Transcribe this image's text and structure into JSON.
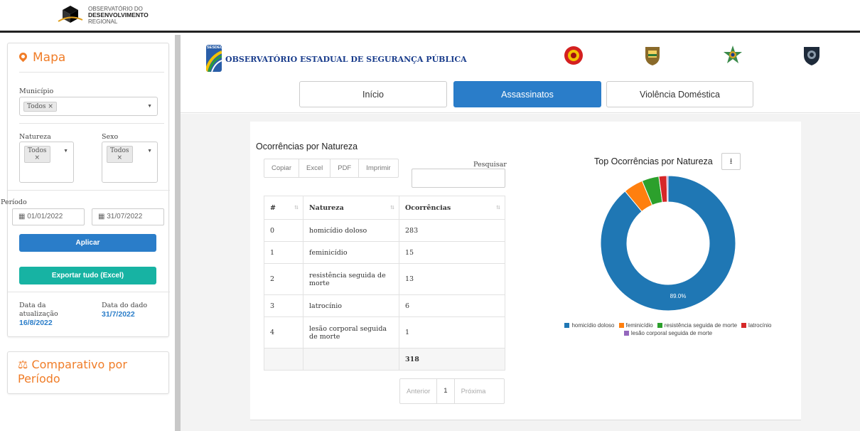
{
  "brand": {
    "line1": "OBSERVATÓRIO DO",
    "line2": "DESENVOLVIMENTO",
    "line3": "REGIONAL"
  },
  "sidebar": {
    "mapa_title": "Mapa",
    "municipio_label": "Município",
    "municipio_tag": "Todos ×",
    "natureza_label": "Natureza",
    "natureza_tag_1": "Todos",
    "natureza_tag_2": "×",
    "sexo_label": "Sexo",
    "sexo_tag_1": "Todos",
    "sexo_tag_2": "×",
    "periodo_label": "Período",
    "date_start": "01/01/2022",
    "date_end": "31/07/2022",
    "aplicar": "Aplicar",
    "exportar": "Exportar tudo (Excel)",
    "data_atualizacao_label_1": "Data da",
    "data_atualizacao_label_2": "atualização",
    "data_atualizacao": "16/8/2022",
    "data_dado_label": "Data do dado",
    "data_dado": "31/7/2022",
    "comparativo_line1": "Comparativo por",
    "comparativo_line2": "Período"
  },
  "header": {
    "sesdec": "SESDEC",
    "title": "OBSERVATÓRIO ESTADUAL DE SEGURANÇA PÚBLICA",
    "tabs": [
      {
        "label": "Início"
      },
      {
        "label": "Assassinatos"
      },
      {
        "label": "Violência Doméstica"
      }
    ]
  },
  "table_section": {
    "title": "Ocorrências por Natureza",
    "buttons": [
      "Copiar",
      "Excel",
      "PDF",
      "Imprimir"
    ],
    "search_label": "Pesquisar",
    "columns": [
      "#",
      "Natureza",
      "Ocorrências"
    ],
    "rows": [
      {
        "idx": "0",
        "natureza": "homicídio doloso",
        "ocorrencias": "283"
      },
      {
        "idx": "1",
        "natureza": "feminicídio",
        "ocorrencias": "15"
      },
      {
        "idx": "2",
        "natureza": "resistência seguida de morte",
        "ocorrencias": "13"
      },
      {
        "idx": "3",
        "natureza": "latrocínio",
        "ocorrencias": "6"
      },
      {
        "idx": "4",
        "natureza": "lesão corporal seguida de morte",
        "ocorrencias": "1"
      }
    ],
    "total": "318",
    "pager": {
      "prev": "Anterior",
      "page": "1",
      "next": "Próxima"
    }
  },
  "chart_data": {
    "type": "pie",
    "title": "Top Ocorrências por Natureza",
    "donut": true,
    "categories": [
      "homicídio doloso",
      "feminicídio",
      "resistência seguida de morte",
      "latrocínio",
      "lesão corporal seguida de morte"
    ],
    "values": [
      283,
      15,
      13,
      6,
      1
    ],
    "colors": [
      "#1f77b4",
      "#ff7f0e",
      "#2ca02c",
      "#d62728",
      "#9467bd"
    ],
    "data_labels": [
      "89.0%"
    ],
    "legend_position": "bottom"
  }
}
